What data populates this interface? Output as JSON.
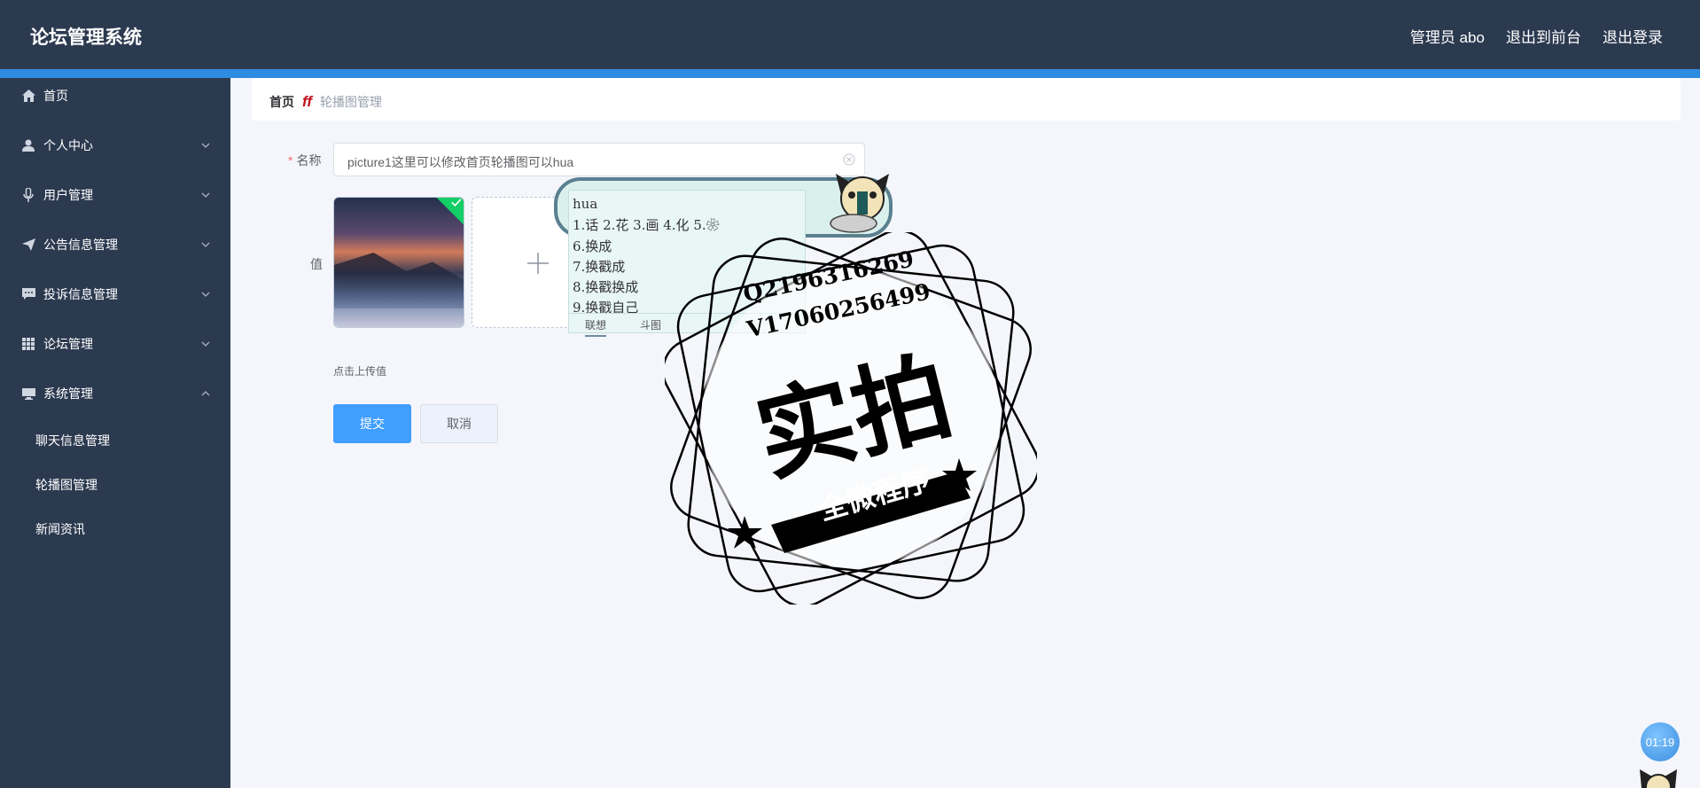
{
  "header": {
    "title": "论坛管理系统",
    "admin_label": "管理员 abo",
    "to_front_label": "退出到前台",
    "logout_label": "退出登录"
  },
  "sidebar": {
    "items": [
      {
        "label": "首页",
        "icon": "home-icon",
        "has_children": false
      },
      {
        "label": "个人中心",
        "icon": "user-icon",
        "has_children": true
      },
      {
        "label": "用户管理",
        "icon": "microphone-icon",
        "has_children": true
      },
      {
        "label": "公告信息管理",
        "icon": "send-icon",
        "has_children": true
      },
      {
        "label": "投诉信息管理",
        "icon": "chat-icon",
        "has_children": true
      },
      {
        "label": "论坛管理",
        "icon": "grid-icon",
        "has_children": true
      },
      {
        "label": "系统管理",
        "icon": "monitor-icon",
        "has_children": true,
        "expanded": true
      }
    ],
    "sub_items": [
      "聊天信息管理",
      "轮播图管理",
      "新闻资讯"
    ]
  },
  "breadcrumb": {
    "home": "首页",
    "separator": "ff",
    "current": "轮播图管理"
  },
  "form": {
    "name_label": "名称",
    "name_value": "picture1这里可以修改首页轮播图可以hua",
    "value_label": "值",
    "upload_hint": "点击上传值",
    "submit_label": "提交",
    "cancel_label": "取消"
  },
  "ime": {
    "pinyin": "hua",
    "line1": "1.话 2.花 3.画 4.化 5.❀",
    "candidates": [
      "6.换成",
      "7.换戳成",
      "8.换戳换成",
      "9.换戳自己"
    ],
    "tab_lianxiang": "联想",
    "tab_doutu": "斗图"
  },
  "watermark": {
    "qq": "Q2196316269",
    "vx": "V17060256499",
    "main": "实拍",
    "sub": "全微程序"
  },
  "timer": "01:19",
  "colors": {
    "header_bg": "#2c3a50",
    "accent": "#2e8ce0",
    "primary_button": "#409eff",
    "success_badge": "#13ce66",
    "required_star": "#f56c6c"
  }
}
